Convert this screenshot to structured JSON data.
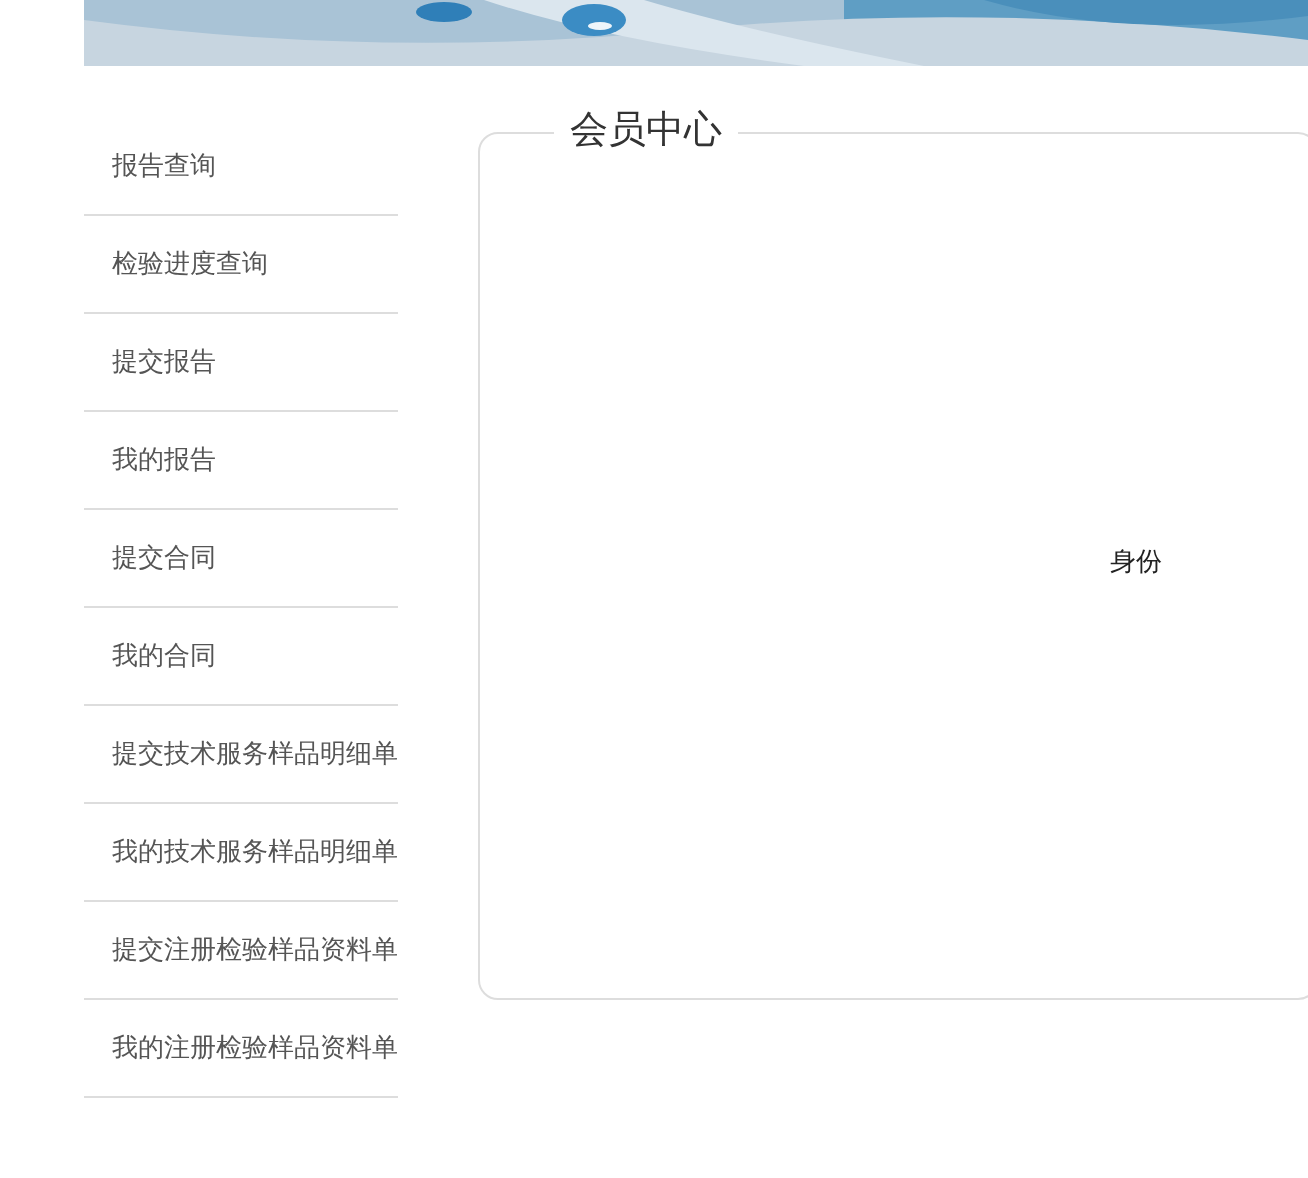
{
  "menu": [
    {
      "label": "报告查询"
    },
    {
      "label": "检验进度查询"
    },
    {
      "label": "提交报告"
    },
    {
      "label": "我的报告"
    },
    {
      "label": "提交合同"
    },
    {
      "label": "我的合同"
    },
    {
      "label": "提交技术服务样品明细单"
    },
    {
      "label": "我的技术服务样品明细单"
    },
    {
      "label": "提交注册检验样品资料单"
    },
    {
      "label": "我的注册检验样品资料单"
    }
  ],
  "panel": {
    "title": "会员中心",
    "content": "身份"
  }
}
